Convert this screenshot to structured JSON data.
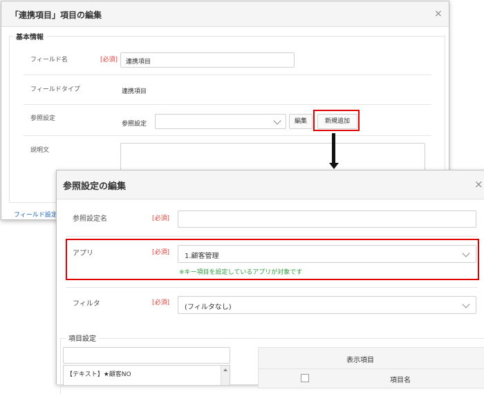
{
  "dialog1": {
    "title": "「連携項目」項目の編集",
    "section_title": "基本情報",
    "required_label": "[必須]",
    "fields": {
      "field_name_label": "フィールド名",
      "field_name_value": "連携項目",
      "field_type_label": "フィールドタイプ",
      "field_type_value": "連携項目",
      "ref_setting_label": "参照設定",
      "ref_setting_inner_label": "参照設定",
      "edit_button": "編集",
      "new_button": "新規追加",
      "description_label": "説明文"
    },
    "footer_link": "フィールド設定"
  },
  "dialog2": {
    "title": "参照設定の編集",
    "required_label": "[必須]",
    "ref_name_label": "参照設定名",
    "ref_name_value": "",
    "app_label": "アプリ",
    "app_value": "1.顧客管理",
    "app_hint": "※キー項目を設定しているアプリが対象です",
    "filter_label": "フィルタ",
    "filter_value": "(フィルタなし)",
    "item_settings_title": "項目設定",
    "list_item": "【テキスト】★顧客NO",
    "display_items_header": "表示項目",
    "item_name_header": "項目名"
  },
  "colors": {
    "highlight": "#e00000",
    "hint": "#2e9e3e",
    "required": "#e53935",
    "link": "#1a62b8"
  }
}
